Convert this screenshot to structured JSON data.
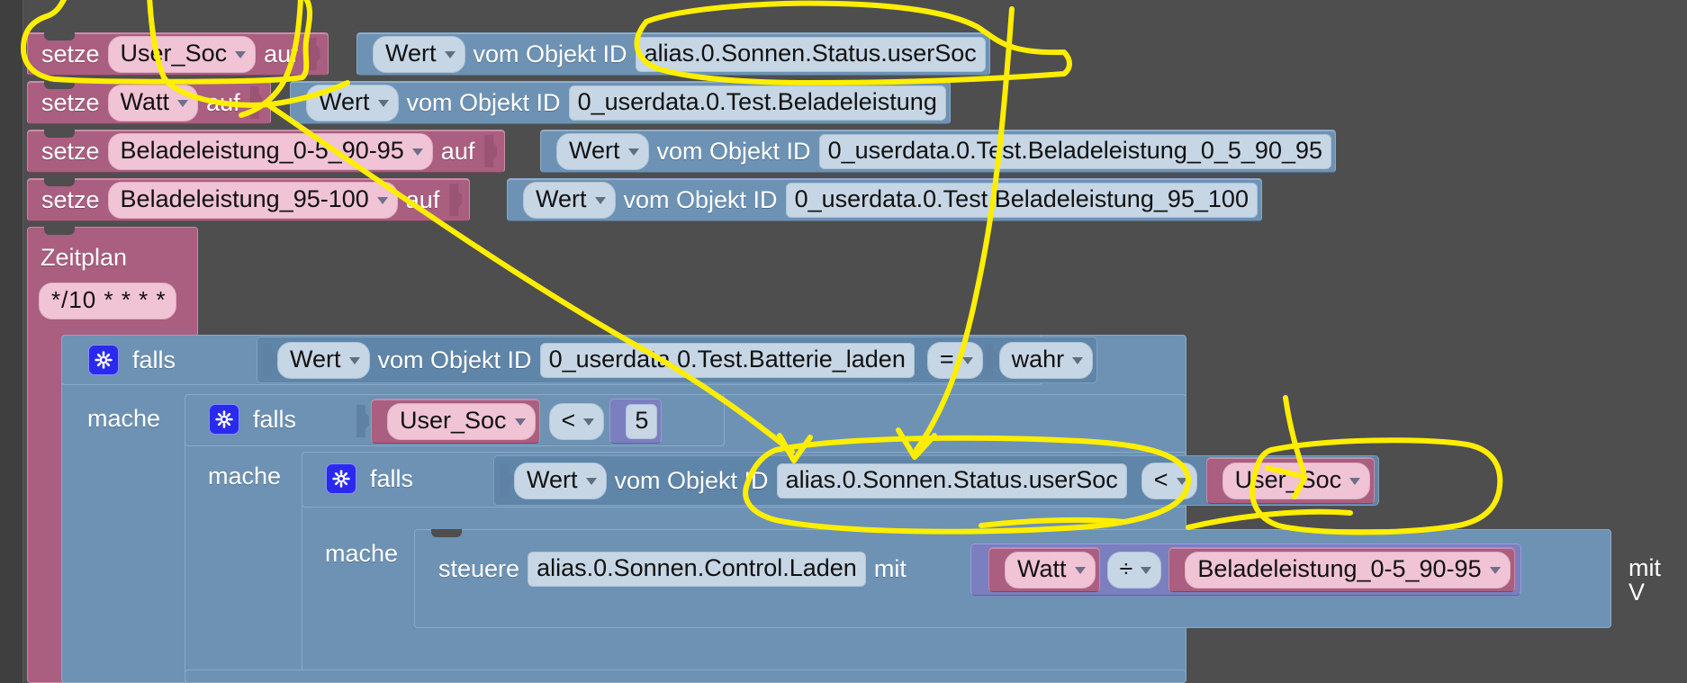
{
  "app": {
    "type": "blockly-visual-script-editor",
    "language": "de",
    "canvas_bg": "#4e4e4e",
    "annotation_color": "#ffee00"
  },
  "palette": {
    "variable_block": "#aa5e80",
    "variable_field": "#f0c3d5",
    "value_block": "#6d92b4",
    "value_field": "#c6d6e4",
    "math_block": "#7b7fc0",
    "gear_icon": "#2a2aee"
  },
  "labels": {
    "setze": "setze",
    "auf": "auf",
    "vom_objekt_id": "vom Objekt ID",
    "falls": "falls",
    "mache": "mache",
    "steuere": "steuere",
    "mit": "mit",
    "mit_verzoegerung_partial": "mit V",
    "zeitplan": "Zeitplan"
  },
  "icons": {
    "gear": "gear-icon",
    "dropdown": "chevron-down-icon"
  },
  "statements": [
    {
      "id": "setze-user-soc",
      "keyword": "setze",
      "variable": "User_Soc",
      "connector": "auf",
      "value_type": "Wert",
      "value_label": "vom Objekt ID",
      "object_id": "alias.0.Sonnen.Status.userSoc",
      "annotated": true
    },
    {
      "id": "setze-watt",
      "keyword": "setze",
      "variable": "Watt",
      "connector": "auf",
      "value_type": "Wert",
      "value_label": "vom Objekt ID",
      "object_id": "0_userdata.0.Test.Beladeleistung",
      "annotated": false
    },
    {
      "id": "setze-beladeleistung-0-5-90-95",
      "keyword": "setze",
      "variable": "Beladeleistung_0-5_90-95",
      "connector": "auf",
      "value_type": "Wert",
      "value_label": "vom Objekt ID",
      "object_id": "0_userdata.0.Test.Beladeleistung_0_5_90_95",
      "annotated": false
    },
    {
      "id": "setze-beladeleistung-95-100",
      "keyword": "setze",
      "variable": "Beladeleistung_95-100",
      "connector": "auf",
      "value_type": "Wert",
      "value_label": "vom Objekt ID",
      "object_id": "0_userdata.0.Test.Beladeleistung_95_100",
      "annotated": false
    }
  ],
  "schedule": {
    "title": "Zeitplan",
    "cron": "*/10 * * * *"
  },
  "conditions": [
    {
      "id": "if-batterie-laden",
      "keyword": "falls",
      "do_label": "mache",
      "left_type": "Wert",
      "left_label": "vom Objekt ID",
      "left_object_id": "0_userdata.0.Test.Batterie_laden",
      "operator": "=",
      "right_value": "wahr",
      "right_kind": "boolean-dropdown"
    },
    {
      "id": "if-user-soc-lt-5",
      "keyword": "falls",
      "do_label": "mache",
      "left_variable": "User_Soc",
      "operator": "<",
      "right_value": "5",
      "right_kind": "number"
    },
    {
      "id": "if-usersoc-lt-user-soc",
      "keyword": "falls",
      "do_label": "mache",
      "left_type": "Wert",
      "left_label": "vom Objekt ID",
      "left_object_id": "alias.0.Sonnen.Status.userSoc",
      "operator": "<",
      "right_variable": "User_Soc",
      "right_kind": "variable",
      "annotated_left": true,
      "annotated_right": true
    }
  ],
  "action": {
    "id": "steuere-laden",
    "keyword": "steuere",
    "object_id": "alias.0.Sonnen.Control.Laden",
    "with_label": "mit",
    "expression": {
      "left_variable": "Watt",
      "operator": "÷",
      "right_variable": "Beladeleistung_0-5_90-95"
    },
    "trailing_label": "mit V"
  },
  "annotations": [
    {
      "name": "circle-setze-user-soc",
      "shape": "lasso",
      "target": "setze-user-soc block"
    },
    {
      "name": "circle-object-id-usersoc-top",
      "shape": "lasso",
      "target": "alias.0.Sonnen.Status.userSoc (top row)"
    },
    {
      "name": "circle-object-id-usersoc-cond",
      "shape": "lasso",
      "target": "alias.0.Sonnen.Status.userSoc (condition)"
    },
    {
      "name": "circle-user-soc-variable-cond",
      "shape": "lasso",
      "target": "User_Soc (condition right side)"
    },
    {
      "name": "arrow-top-to-condition",
      "shape": "arrow",
      "target": "links top object id to condition"
    },
    {
      "name": "line-setze-to-user-soc-var",
      "shape": "line",
      "target": "links setze block to User_Soc variable"
    }
  ]
}
